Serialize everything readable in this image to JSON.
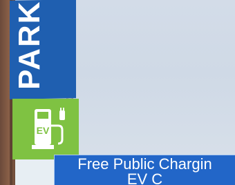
{
  "sign": {
    "top_text": "PARK",
    "ev_label": "EV"
  },
  "caption": {
    "line1": "Free Public Chargin",
    "line2": "EV C"
  },
  "colors": {
    "sign_blue": "#1f5fb0",
    "sign_green": "#7fc242",
    "caption_bg": "#2266c8"
  }
}
